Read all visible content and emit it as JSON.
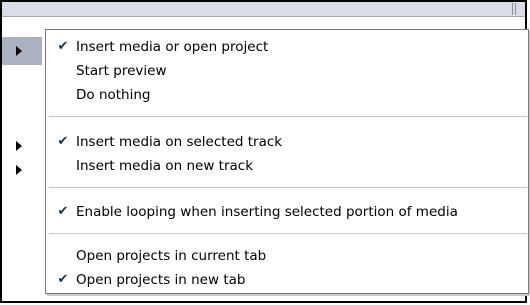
{
  "menu": {
    "groups": [
      {
        "items": [
          {
            "label": "Insert media or open project",
            "checked": true,
            "check_glyph": "✔"
          },
          {
            "label": "Start preview",
            "checked": false,
            "check_glyph": ""
          },
          {
            "label": "Do nothing",
            "checked": false,
            "check_glyph": ""
          }
        ]
      },
      {
        "items": [
          {
            "label": "Insert media on selected track",
            "checked": true,
            "check_glyph": "✔"
          },
          {
            "label": "Insert media on new track",
            "checked": false,
            "check_glyph": ""
          }
        ]
      },
      {
        "items": [
          {
            "label": "Enable looping when inserting selected portion of media",
            "checked": true,
            "check_glyph": "✔"
          }
        ]
      },
      {
        "items": [
          {
            "label": "Open projects in current tab",
            "checked": false,
            "check_glyph": ""
          },
          {
            "label": "Open projects in new tab",
            "checked": true,
            "check_glyph": "✔"
          }
        ]
      }
    ]
  },
  "icons": {
    "check": "check-mark-icon",
    "submenu_arrow": "triangle-right-icon",
    "grip": "resize-grip-icon"
  },
  "colors": {
    "highlight": "#aab2c0",
    "strip": "#d9dde7",
    "check": "#1c2a55"
  }
}
